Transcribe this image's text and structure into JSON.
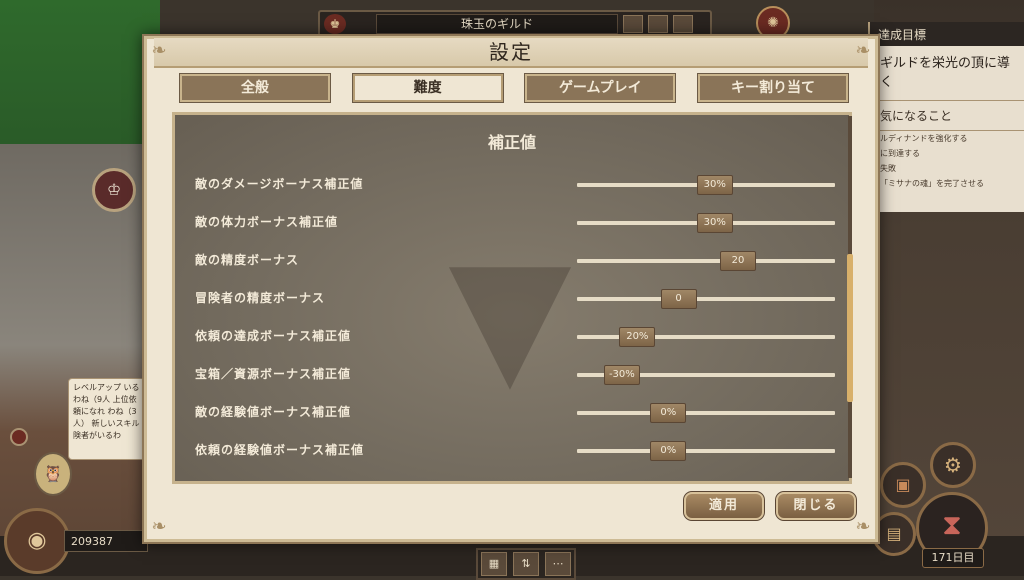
{
  "guild": {
    "name": "珠玉のギルド",
    "emblem_icon": "crest-icon"
  },
  "objective": {
    "header": "達成目標",
    "line": "ギルドを栄光の頂に導く",
    "sub_header": "気になること",
    "notes": [
      "ルディナンドを強化する",
      "に到達する",
      "失敗",
      "「ミサナの魂」を完了させる"
    ]
  },
  "chat_bubble": {
    "text": "レベルアップ いるわね（9人 上位依頼になれ わね（3人） 新しいスキル 険者がいるわ"
  },
  "gold": {
    "amount": "209387"
  },
  "day": {
    "label": "171日目"
  },
  "dialog": {
    "title": "設定",
    "tabs": [
      {
        "label": "全般",
        "active": false
      },
      {
        "label": "難度",
        "active": true
      },
      {
        "label": "ゲームプレイ",
        "active": false
      },
      {
        "label": "キー割り当て",
        "active": false
      }
    ],
    "section_title": "補正値",
    "modifiers": [
      {
        "label": "敵のダメージボーナス補正値",
        "value": "30%",
        "level": 0.53
      },
      {
        "label": "敵の体力ボーナス補正値",
        "value": "30%",
        "level": 0.53
      },
      {
        "label": "敵の精度ボーナス",
        "value": "20",
        "level": 0.62
      },
      {
        "label": "冒険者の精度ボーナス",
        "value": "0",
        "level": 0.39
      },
      {
        "label": "依頼の達成ボーナス補正値",
        "value": "20%",
        "level": 0.23
      },
      {
        "label": "宝箱／資源ボーナス補正値",
        "value": "-30%",
        "level": 0.17
      },
      {
        "label": "敵の経験値ボーナス補正値",
        "value": "0%",
        "level": 0.35
      },
      {
        "label": "依頼の経験値ボーナス補正値",
        "value": "0%",
        "level": 0.35
      }
    ],
    "apply_label": "適用",
    "close_label": "閉じる"
  },
  "colors": {
    "accent": "#8a7458",
    "panel": "#746c5f",
    "parchment": "#efe6d3",
    "thumb": "#d8b06a"
  }
}
